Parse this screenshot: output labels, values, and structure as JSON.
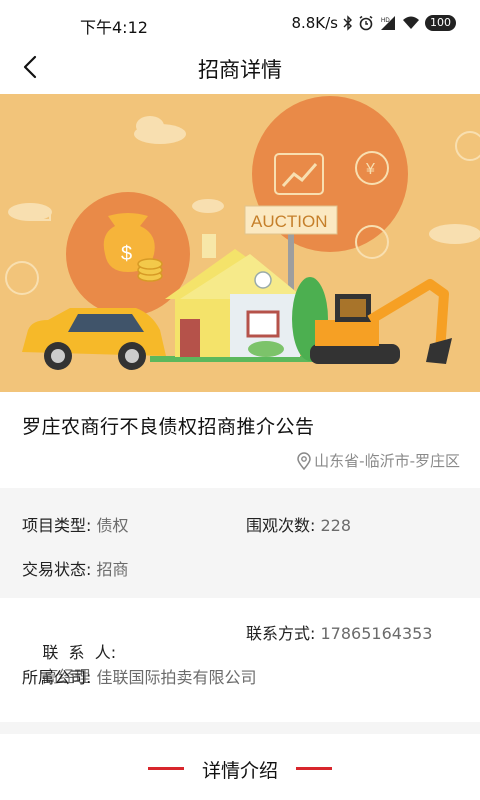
{
  "status_bar": {
    "time": "下午4:12",
    "speed": "8.8K/s",
    "battery": "100",
    "icons": [
      "bluetooth-icon",
      "alarm-icon",
      "signal-icon",
      "wifi-icon",
      "battery-icon"
    ]
  },
  "nav": {
    "title": "招商详情",
    "back_icon": "chevron-left-icon"
  },
  "banner": {
    "sign_text": "AUCTION",
    "background_color": "#f2c47a"
  },
  "project": {
    "title": "罗庄农商行不良债权招商推介公告",
    "location": "山东省-临沂市-罗庄区",
    "location_icon": "location-pin-icon"
  },
  "details": {
    "type_label": "项目类型:",
    "type_value": "债权",
    "views_label": "围观次数:",
    "views_value": "228",
    "status_label": "交易状态:",
    "status_value": "招商",
    "contact_label": "联  系  人:",
    "contact_value": "高经理",
    "phone_label": "联系方式:",
    "phone_value": "17865164353",
    "company_label": "所属公司:",
    "company_value": "佳联国际拍卖有限公司"
  },
  "section": {
    "title": "详情介绍",
    "accent_color": "#d8262c"
  }
}
